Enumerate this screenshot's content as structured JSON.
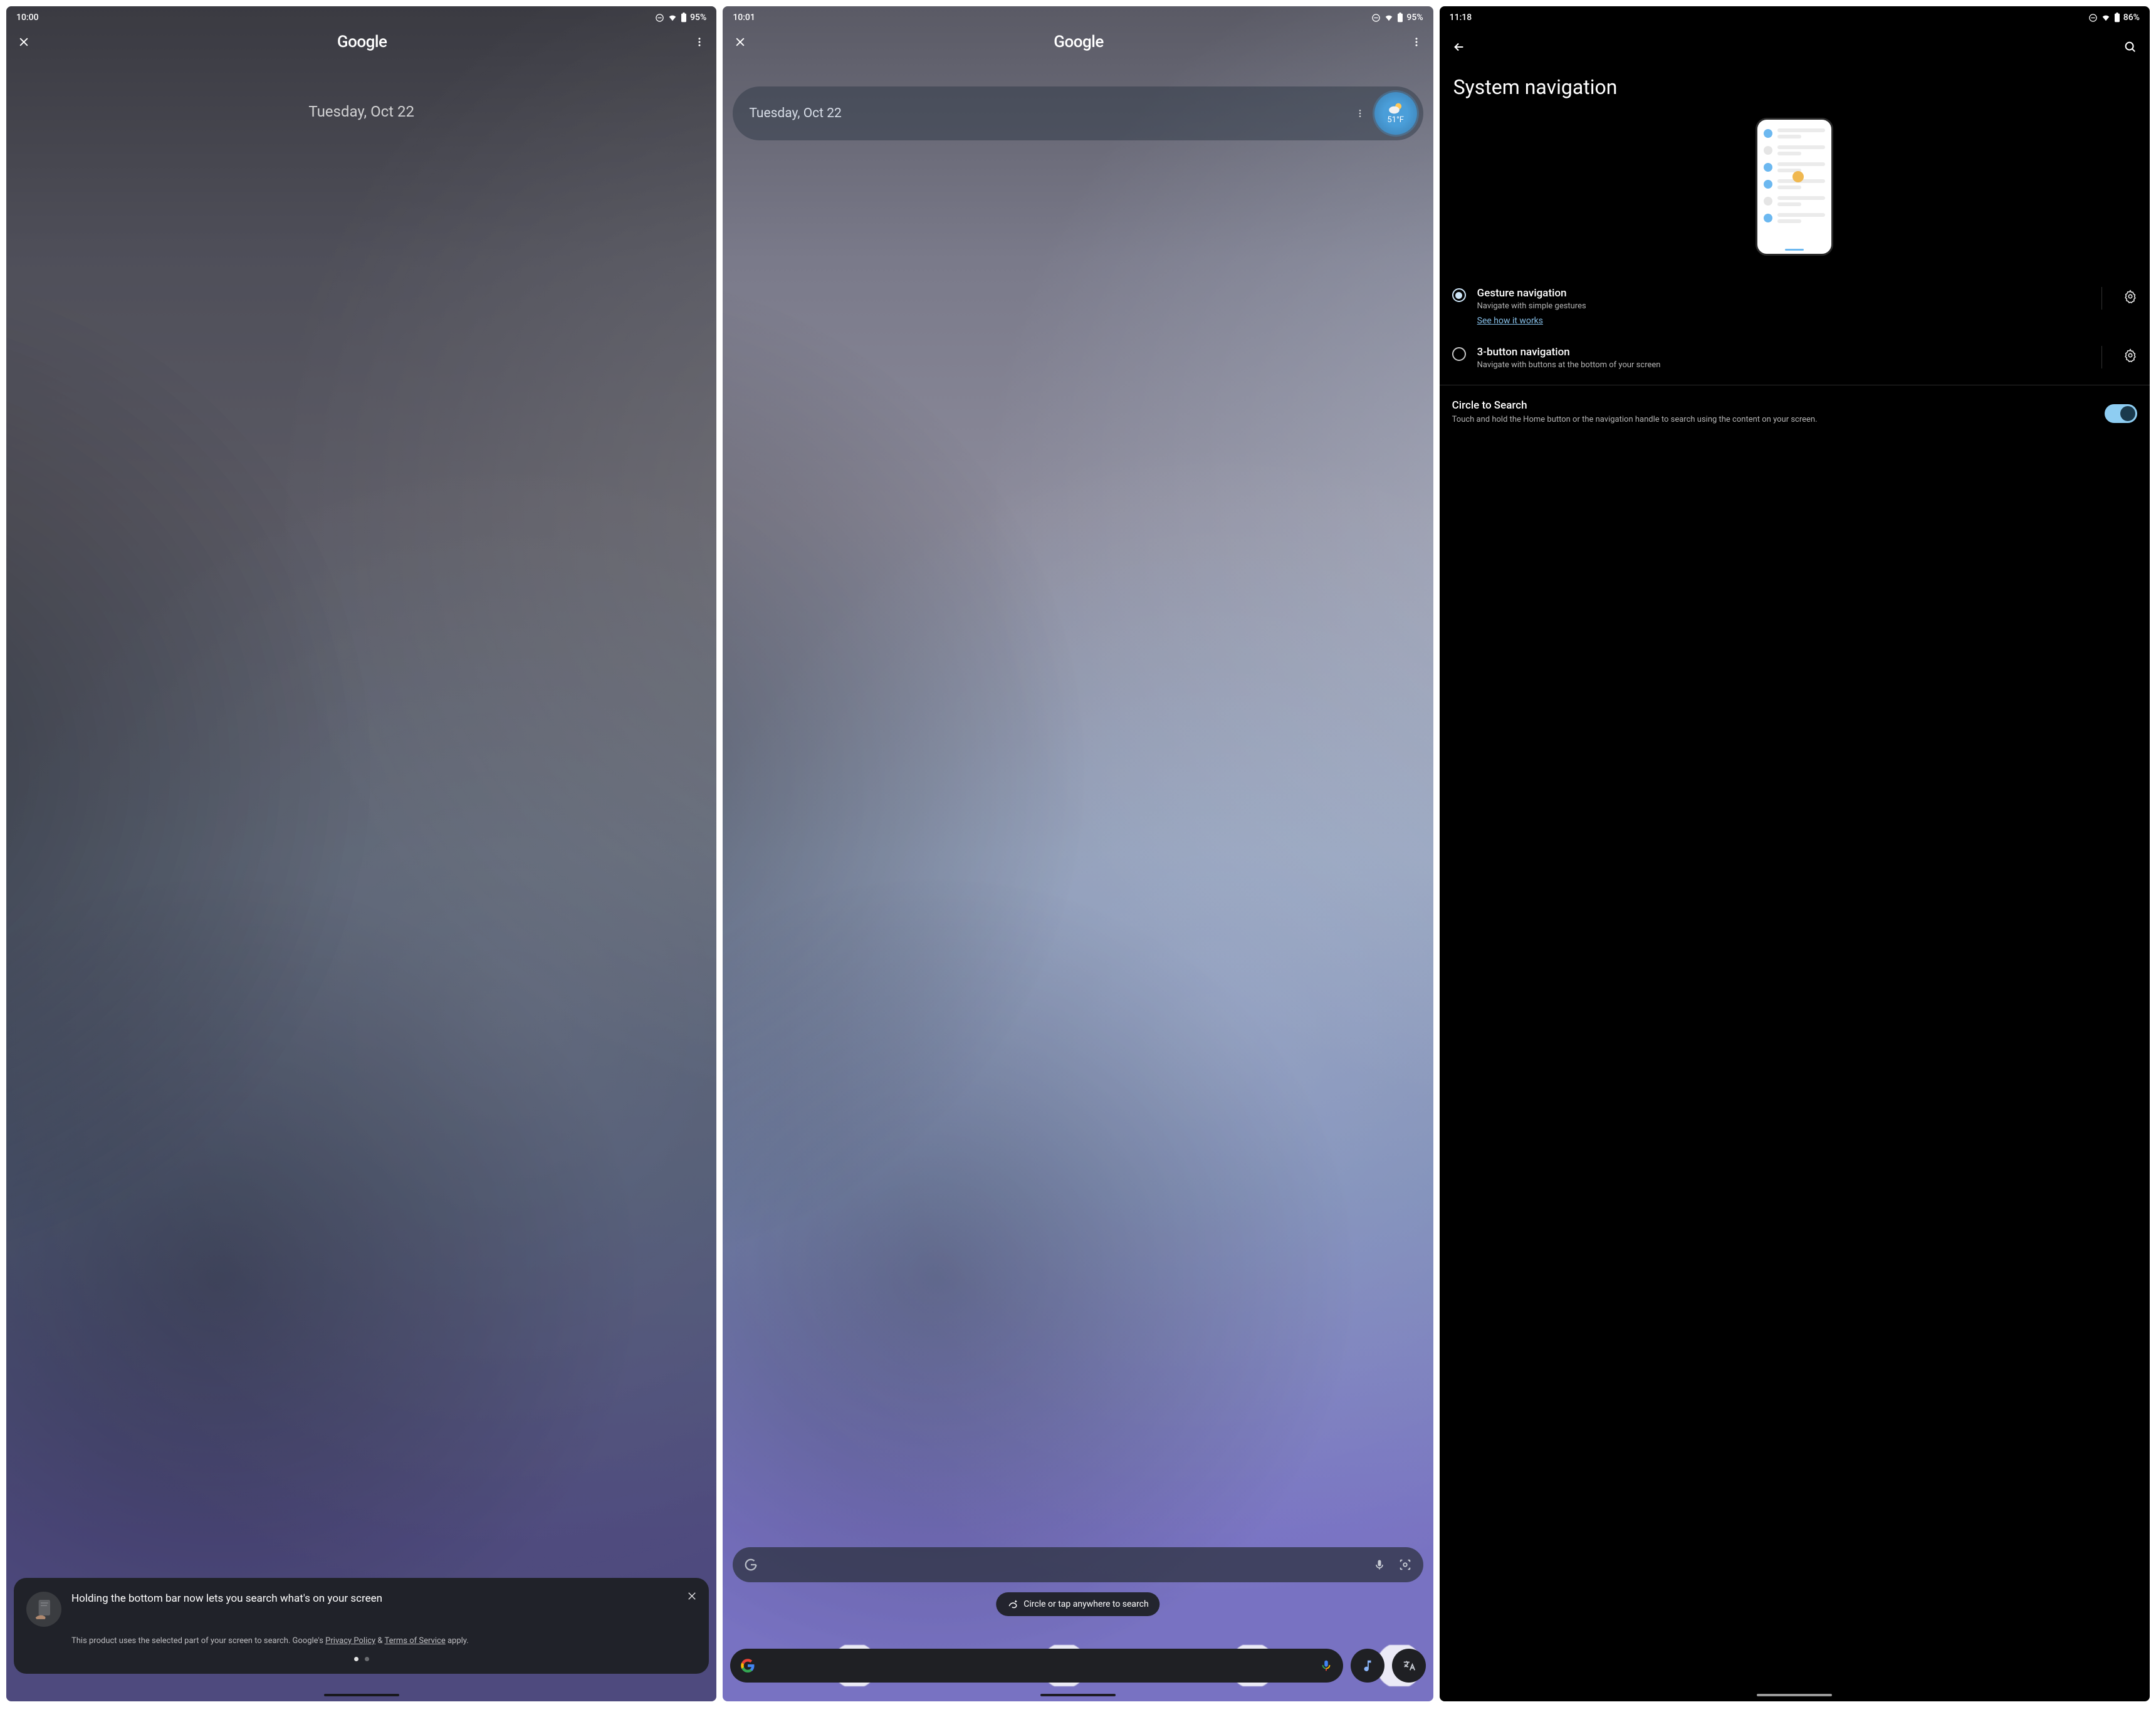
{
  "screen1": {
    "status": {
      "time": "10:00",
      "battery": "95%"
    },
    "title": "Google",
    "date": "Tuesday, Oct 22",
    "tip": {
      "title": "Holding the bottom bar now lets you search what's on your screen",
      "body_pre": "This product uses the selected part of your screen to search. Google's ",
      "privacy": "Privacy Policy",
      "amp": " & ",
      "tos": "Terms of Service",
      "body_post": " apply."
    }
  },
  "screen2": {
    "status": {
      "time": "10:01",
      "battery": "95%"
    },
    "title": "Google",
    "glance_date": "Tuesday, Oct 22",
    "weather_temp": "51°F",
    "circle_prompt": "Circle or tap anywhere to search"
  },
  "screen3": {
    "status": {
      "time": "11:18",
      "battery": "86%"
    },
    "page_title": "System navigation",
    "gesture": {
      "title": "Gesture navigation",
      "sub": "Navigate with simple gestures",
      "link": "See how it works"
    },
    "threebutton": {
      "title": "3-button navigation",
      "sub": "Navigate with buttons at the bottom of your screen"
    },
    "cts": {
      "title": "Circle to Search",
      "sub": "Touch and hold the Home button or the navigation handle to search using the content on your screen."
    }
  }
}
